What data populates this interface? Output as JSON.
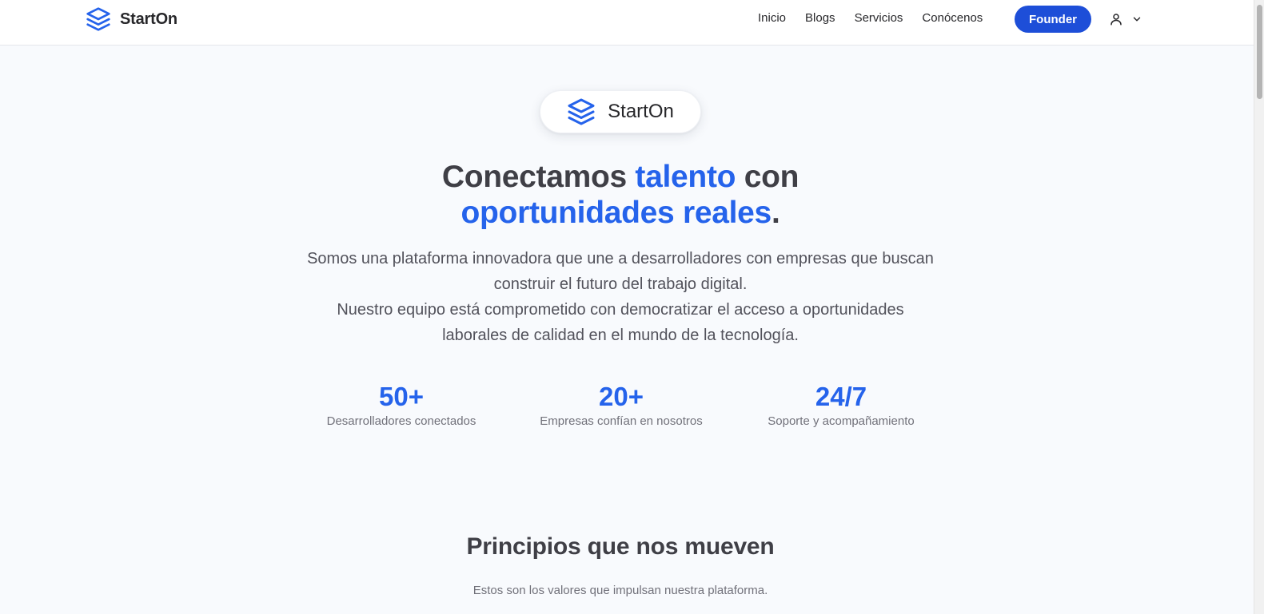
{
  "brand": {
    "name": "StartOn",
    "icon": "layers-icon",
    "color": "#2563eb"
  },
  "nav": {
    "links": [
      "Inicio",
      "Blogs",
      "Servicios",
      "Conócenos"
    ],
    "cta_label": "Founder",
    "cta_color": "#1d4ed8",
    "user_icon": "user-icon",
    "dropdown_icon": "chevron-down-icon"
  },
  "hero": {
    "badge_name": "StartOn",
    "title_part1": "Conectamos ",
    "title_accent1": "talento",
    "title_part2": " con",
    "title_accent2": "oportunidades reales",
    "title_end": ".",
    "description_line1": "Somos una plataforma innovadora que une a desarrolladores con empresas que buscan construir el futuro del trabajo digital.",
    "description_line2": "Nuestro equipo está comprometido con democratizar el acceso a oportunidades laborales de calidad en el mundo de la tecnología."
  },
  "stats": [
    {
      "value": "50+",
      "label": "Desarrolladores conectados"
    },
    {
      "value": "20+",
      "label": "Empresas confían en nosotros"
    },
    {
      "value": "24/7",
      "label": "Soporte y acompañamiento"
    }
  ],
  "principles": {
    "title": "Principios que nos mueven",
    "subtitle": "Estos son los valores que impulsan nuestra plataforma."
  },
  "colors": {
    "accent": "#2563eb",
    "background": "#f8fafd",
    "text": "#3f3f46"
  }
}
